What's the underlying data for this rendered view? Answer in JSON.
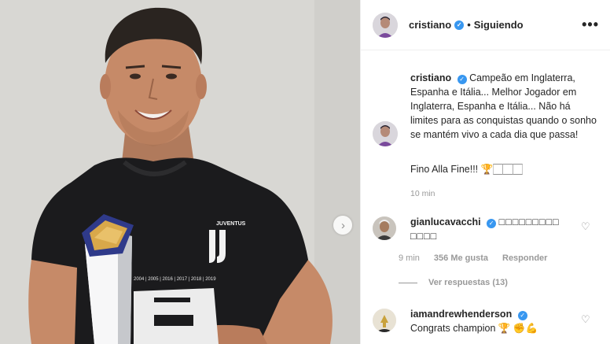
{
  "header": {
    "username": "cristiano",
    "separator": "•",
    "follow_status": "Siguiendo",
    "more_icon": "•••"
  },
  "caption": {
    "username": "cristiano",
    "text": "Campeão em Inglaterra, Espanha e Itália... Melhor Jogador em Inglaterra, Espanha e Itália... Não há limites para as conquistas quando o sonho se mantém vivo a cada dia que passa!",
    "sign_off": "Fino Alla Fine!!! 🏆🏻🏻🏻",
    "time": "10 min"
  },
  "comments": [
    {
      "username": "gianlucavacchi",
      "text": "□□□□□□□□□ □□□□",
      "time": "9 min",
      "likes": "356 Me gusta",
      "reply": "Responder",
      "view_replies": "Ver respuestas (13)"
    },
    {
      "username": "iamandrewhenderson",
      "text": "Congrats champion 🏆 ✊💪"
    }
  ],
  "photo": {
    "next_icon": "›",
    "shirt_logo_text": "JUVENTUS",
    "shirt_print_years": "2004 | 2005 | 2016 | 2017 | 2018 | 2019"
  },
  "icons": {
    "heart": "♡",
    "verified": "✓"
  },
  "colors": {
    "verified_blue": "#3897f0",
    "meta_grey": "#999999",
    "shirt_black": "#1b1b1d"
  }
}
